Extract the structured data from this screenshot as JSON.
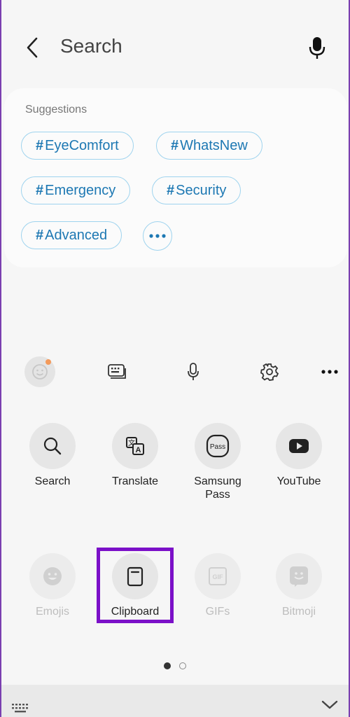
{
  "header": {
    "title": "Search"
  },
  "suggestions": {
    "title": "Suggestions",
    "chips": [
      "EyeComfort",
      "WhatsNew",
      "Emergency",
      "Security",
      "Advanced"
    ],
    "hash": "#"
  },
  "grid": {
    "row1": [
      {
        "label": "Search",
        "icon": "magnifier-icon"
      },
      {
        "label": "Translate",
        "icon": "translate-icon"
      },
      {
        "label": "Samsung\nPass",
        "icon": "samsung-pass-icon",
        "badge": "Pass"
      },
      {
        "label": "YouTube",
        "icon": "youtube-icon"
      }
    ],
    "row2": [
      {
        "label": "Emojis",
        "icon": "emoji-icon"
      },
      {
        "label": "Clipboard",
        "icon": "clipboard-icon"
      },
      {
        "label": "GIFs",
        "icon": "gif-icon",
        "badge": "GIF"
      },
      {
        "label": "Bitmoji",
        "icon": "bitmoji-icon"
      }
    ]
  },
  "colors": {
    "accent_blue": "#1d78b3",
    "highlight_purple": "#7b10c8",
    "badge_orange": "#f39a5b"
  },
  "pagination": {
    "current": 1,
    "total": 2
  }
}
